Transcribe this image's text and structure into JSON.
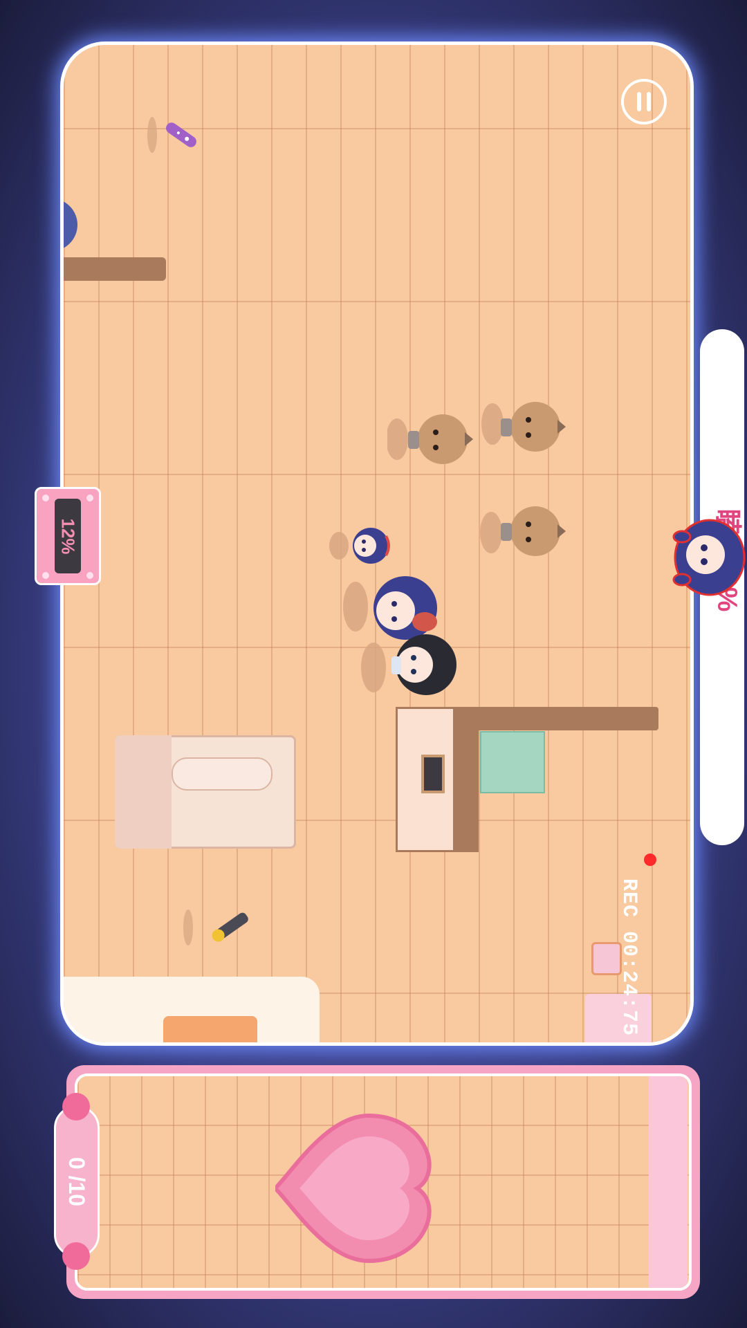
{
  "hud": {
    "pause_icon": "pause-icon",
    "progress_percent_label": "12%",
    "progress_value": 0.12,
    "opponent_label": "瞌睡 0%",
    "rec_label": "REC 00:24:75",
    "collect_counter": "0 /10"
  },
  "items": {
    "candy": "candy-icon",
    "flashlight": "flashlight-icon",
    "heart": "heart-icon"
  },
  "colors": {
    "accent_pink": "#f7a5c4",
    "label_pink": "#e0457e",
    "rec_red": "#ff2a2a",
    "floor": "#f9c9a0",
    "glow": "#6e8cff"
  }
}
